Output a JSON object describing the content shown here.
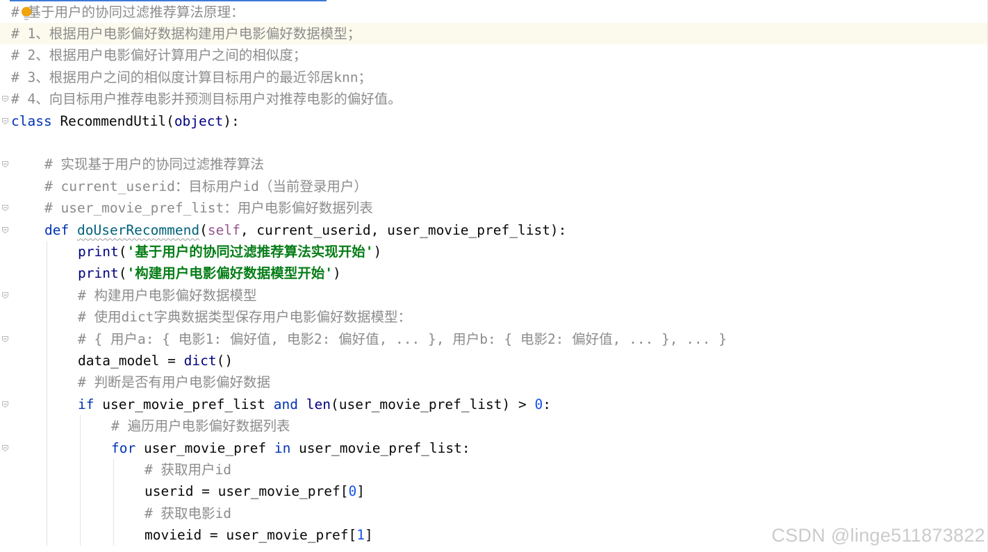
{
  "editor": {
    "lines": [
      [
        {
          "t": "#",
          "c": "cmt"
        },
        {
          "t": " 基于用户的协同过滤推荐算法原理：",
          "c": "cmt"
        }
      ],
      [
        {
          "t": "# 1、根据用户电影偏好数据构建用户电影偏好数据模型；",
          "c": "cmt"
        }
      ],
      [
        {
          "t": "# 2、根据用户电影偏好计算用户之间的相似度；",
          "c": "cmt"
        }
      ],
      [
        {
          "t": "# 3、根据用户之间的相似度计算目标用户的最近邻居knn；",
          "c": "cmt"
        }
      ],
      [
        {
          "t": "# 4、向目标用户推荐电影并预测目标用户对推荐电影的偏好值。",
          "c": "cmt"
        }
      ],
      [
        {
          "t": "class",
          "c": "kw"
        },
        {
          "t": " RecommendUtil("
        },
        {
          "t": "object",
          "c": "bi"
        },
        {
          "t": "):"
        }
      ],
      [],
      [
        {
          "t": "# 实现基于用户的协同过滤推荐算法",
          "c": "cmt"
        }
      ],
      [
        {
          "t": "# current_userid：目标用户id（当前登录用户）",
          "c": "cmt"
        }
      ],
      [
        {
          "t": "# user_movie_pref_list：用户电影偏好数据列表",
          "c": "cmt"
        }
      ],
      [
        {
          "t": "def",
          "c": "kw"
        },
        {
          "t": " "
        },
        {
          "t": "doUserRecommend",
          "c": "fn-def fn-squiggle"
        },
        {
          "t": "("
        },
        {
          "t": "self",
          "c": "self-kw"
        },
        {
          "t": ", current_userid, user_movie_pref_list):"
        }
      ],
      [
        {
          "t": "print",
          "c": "bi"
        },
        {
          "t": "("
        },
        {
          "t": "'基于用户的协同过滤推荐算法实现开始'",
          "c": "str"
        },
        {
          "t": ")"
        }
      ],
      [
        {
          "t": "print",
          "c": "bi"
        },
        {
          "t": "("
        },
        {
          "t": "'构建用户电影偏好数据模型开始'",
          "c": "str"
        },
        {
          "t": ")"
        }
      ],
      [
        {
          "t": "# 构建用户电影偏好数据模型",
          "c": "cmt"
        }
      ],
      [
        {
          "t": "# 使用dict字典数据类型保存用户电影偏好数据模型：",
          "c": "cmt"
        }
      ],
      [
        {
          "t": "# { 用户a: { 电影1: 偏好值, 电影2: 偏好值, ... }, 用户b: { 电影2: 偏好值, ... }, ... }",
          "c": "cmt"
        }
      ],
      [
        {
          "t": "data_model = "
        },
        {
          "t": "dict",
          "c": "bi"
        },
        {
          "t": "()"
        }
      ],
      [
        {
          "t": "# 判断是否有用户电影偏好数据",
          "c": "cmt"
        }
      ],
      [
        {
          "t": "if",
          "c": "kw"
        },
        {
          "t": " user_movie_pref_list "
        },
        {
          "t": "and",
          "c": "kw"
        },
        {
          "t": " "
        },
        {
          "t": "len",
          "c": "bi"
        },
        {
          "t": "(user_movie_pref_list) > "
        },
        {
          "t": "0",
          "c": "num"
        },
        {
          "t": ":"
        }
      ],
      [
        {
          "t": "# 遍历用户电影偏好数据列表",
          "c": "cmt"
        }
      ],
      [
        {
          "t": "for",
          "c": "kw"
        },
        {
          "t": " user_movie_pref "
        },
        {
          "t": "in",
          "c": "kw"
        },
        {
          "t": " user_movie_pref_list:"
        }
      ],
      [
        {
          "t": "# 获取用户id",
          "c": "cmt"
        }
      ],
      [
        {
          "t": "userid = user_movie_pref["
        },
        {
          "t": "0",
          "c": "num"
        },
        {
          "t": "]"
        }
      ],
      [
        {
          "t": "# 获取电影id",
          "c": "cmt"
        }
      ],
      [
        {
          "t": "movieid = user_movie_pref["
        },
        {
          "t": "1",
          "c": "num"
        },
        {
          "t": "]"
        }
      ]
    ]
  },
  "colors": {
    "keyword": "#0033b3",
    "builtin": "#000080",
    "comment": "#8c8c8c",
    "string": "#067d17",
    "number": "#1750eb",
    "function": "#00627a",
    "self": "#94558d",
    "caret_line": "#fcfaed"
  },
  "icons": {
    "intention": "lightbulb-icon",
    "fold": "fold-marker-icon"
  },
  "watermark": {
    "text": "CSDN @linge511873822"
  }
}
